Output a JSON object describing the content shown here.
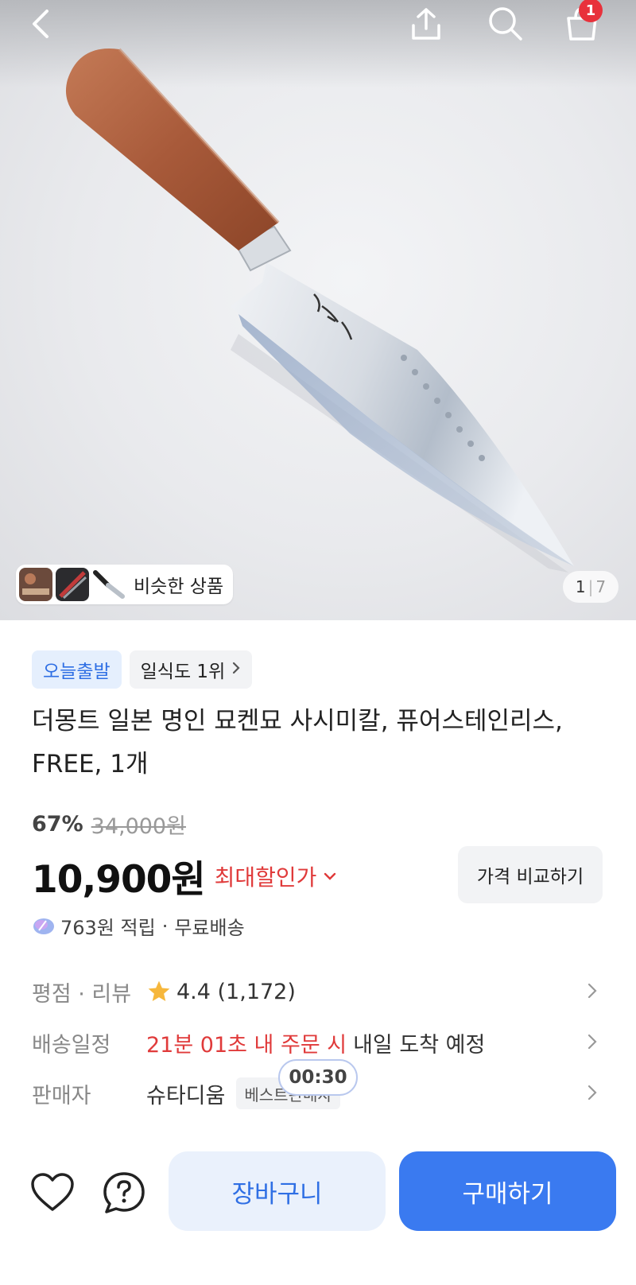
{
  "header": {
    "cart_badge": "1",
    "icons": [
      "back-arrow-icon",
      "share-icon",
      "search-icon",
      "shopping-bag-icon"
    ]
  },
  "gallery": {
    "similar_label": "비슷한 상품",
    "current": "1",
    "separator": "|",
    "total": "7"
  },
  "product": {
    "tag_today": "오늘출발",
    "tag_rank": "일식도 1위",
    "title": "더몽트 일본 명인 묘켄묘 사시미칼, 퓨어스테인리스, FREE, 1개",
    "discount_rate": "67%",
    "original_price": "34,000원",
    "price": "10,900원",
    "max_discount": "최대할인가",
    "compare_button": "가격 비교하기",
    "reward": "763원 적립",
    "reward_sep": "·",
    "shipping": "무료배송"
  },
  "info": {
    "rating_key": "평점 · 리뷰",
    "rating": "4.4 (1,172)",
    "delivery_key": "배송일정",
    "delivery_countdown": "21분 01초 내 주문 시",
    "delivery_eta": "내일 도착 예정",
    "seller_key": "판매자",
    "seller_name": "슈타디움",
    "seller_badge": "베스트판매자",
    "timer": "00:30"
  },
  "bottom": {
    "cart_label": "장바구니",
    "buy_label": "구매하기"
  },
  "colors": {
    "accent": "#3a7af0",
    "accent_light": "#eaf1fc",
    "discount_red": "#e03a3a",
    "star": "#f6b73c"
  }
}
